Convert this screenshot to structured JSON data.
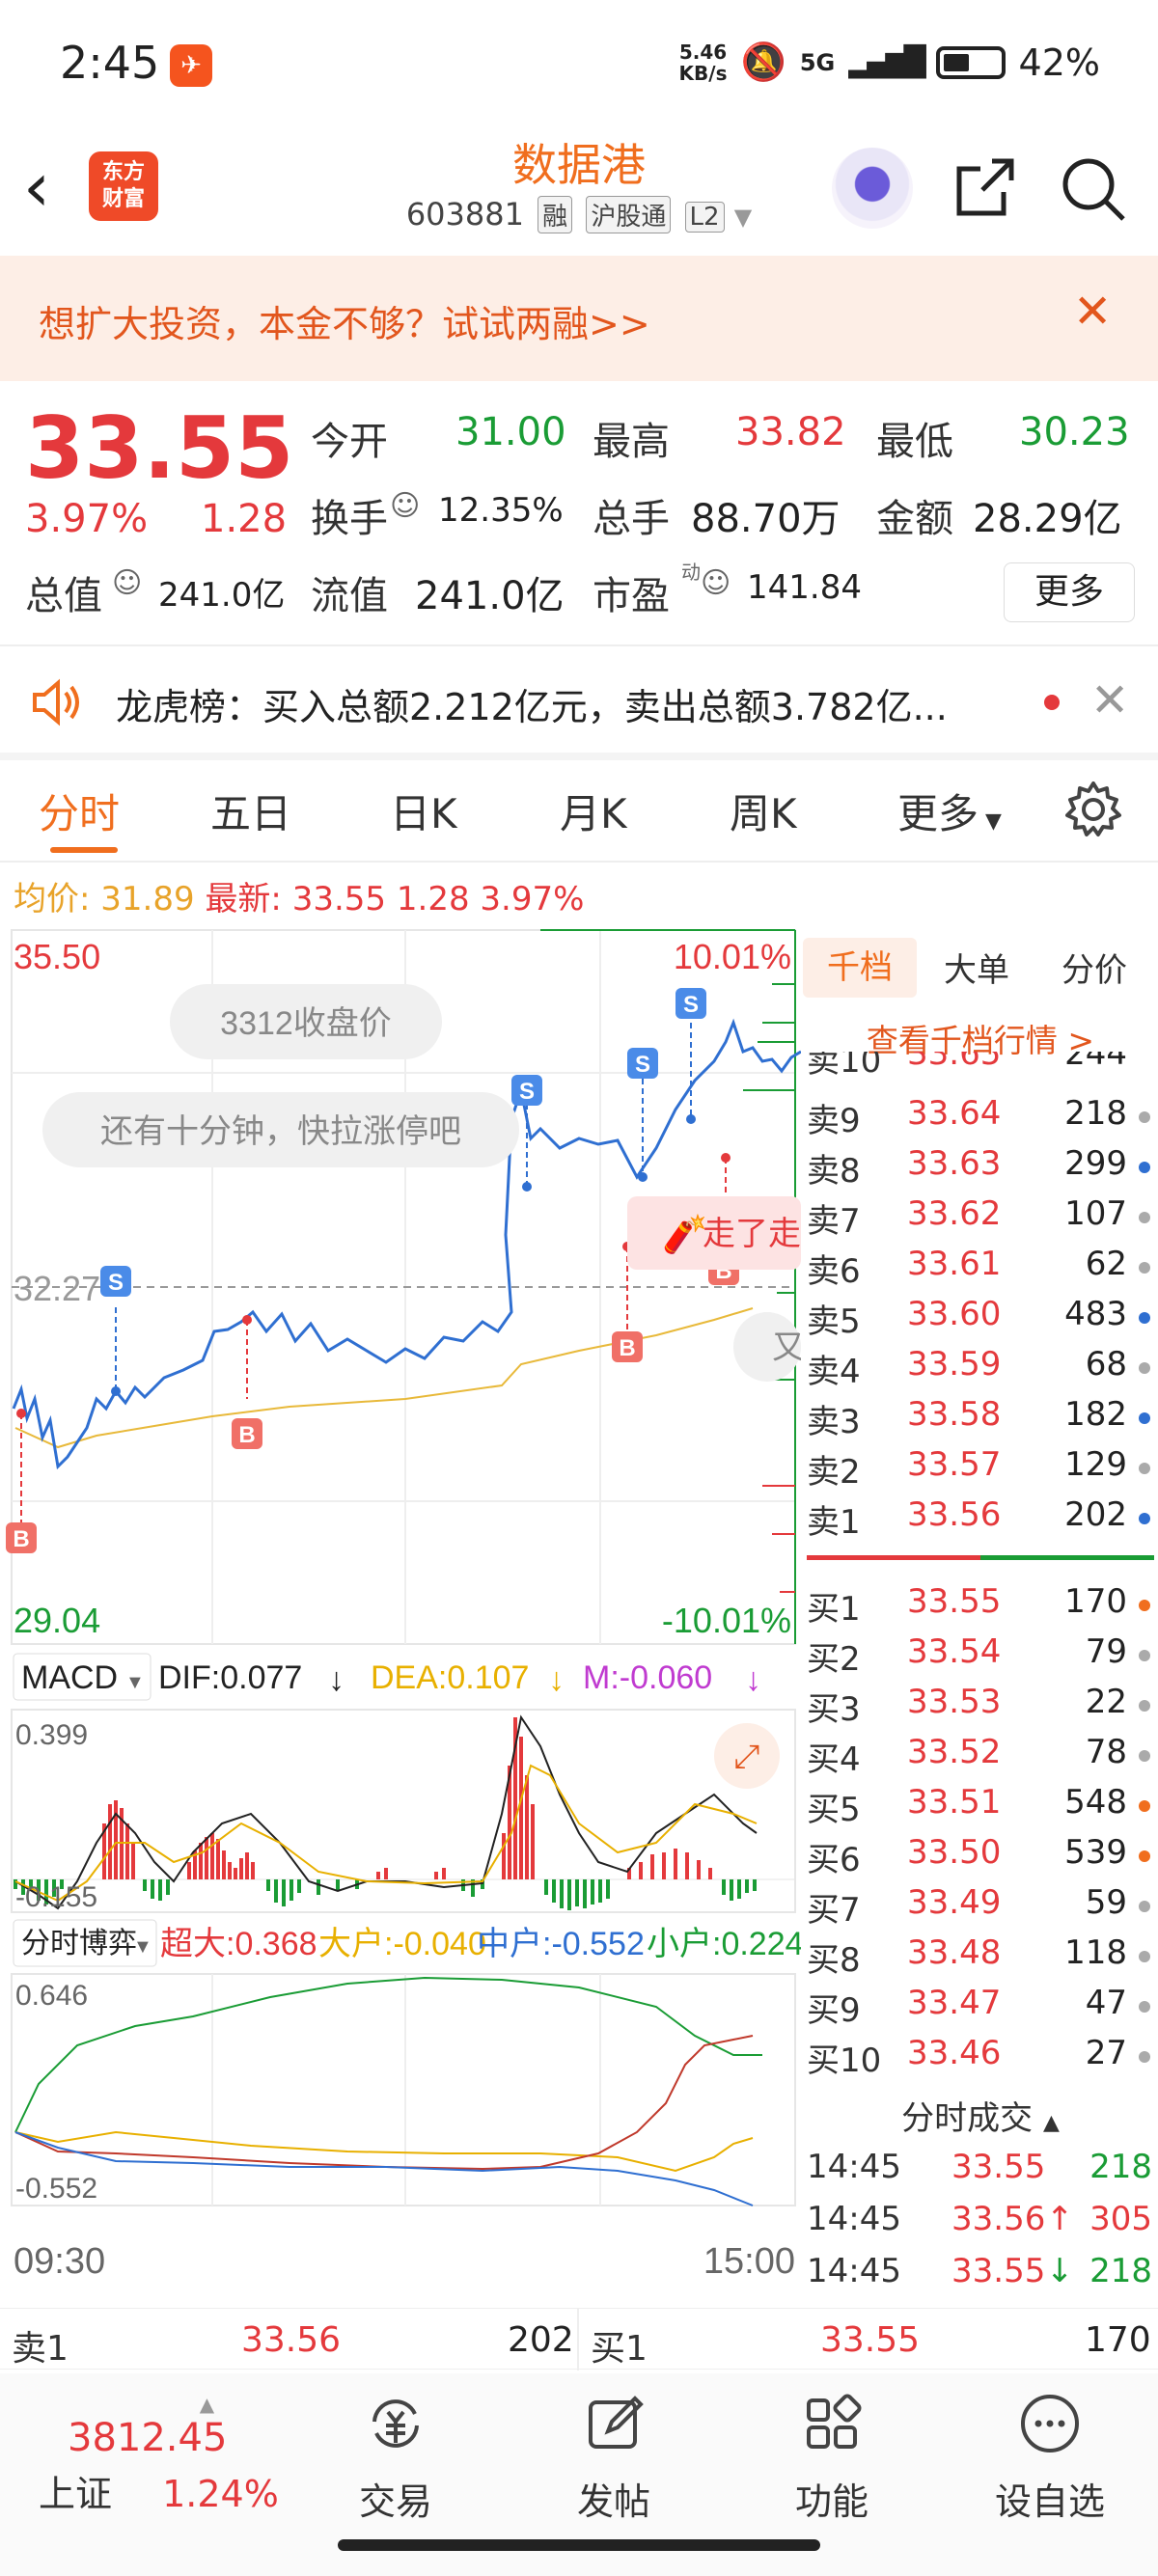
{
  "status": {
    "time": "2:45",
    "speed_value": "5.46",
    "speed_unit": "KB/s",
    "network": "5G",
    "battery": "42%"
  },
  "header": {
    "title": "数据港",
    "code": "603881",
    "tags": [
      "融",
      "沪股通",
      "L2"
    ],
    "logo_line1": "东方",
    "logo_line2": "财富"
  },
  "banner": {
    "text": "想扩大投资，本金不够？试试两融>>"
  },
  "quote": {
    "price": "33.55",
    "change_pct": "3.97%",
    "change": "1.28",
    "open_label": "今开",
    "open": "31.00",
    "high_label": "最高",
    "high": "33.82",
    "low_label": "最低",
    "low": "30.23",
    "turnover_label": "换手",
    "turnover": "12.35%",
    "volume_label": "总手",
    "volume": "88.70万",
    "amount_label": "金额",
    "amount": "28.29亿",
    "mktcap_label": "总值",
    "mktcap": "241.0亿",
    "float_label": "流值",
    "float": "241.0亿",
    "pe_label": "市盈",
    "pe_sup": "动",
    "pe": "141.84",
    "more_label": "更多"
  },
  "news": {
    "text": "龙虎榜：买入总额2.212亿元，卖出总额3.782亿..."
  },
  "tabs": [
    "分时",
    "五日",
    "日K",
    "月K",
    "周K",
    "更多"
  ],
  "infoline": {
    "avg_label": "均价:",
    "avg": "31.89",
    "last_label": "最新:",
    "last": "33.55",
    "chg": "1.28",
    "pct": "3.97%"
  },
  "chart_labels": {
    "top_price": "35.50",
    "top_pct": "10.01%",
    "mid_price": "32.27",
    "bottom_price": "29.04",
    "bottom_pct": "-10.01%",
    "bubble1": "3312收盘价",
    "bubble2": "还有十分钟，快拉涨停吧",
    "tag_walk": "走了走",
    "side_char": "又",
    "macd_name": "MACD",
    "dif": "DIF:0.077",
    "dea": "DEA:0.107",
    "m": "M:-0.060",
    "macd_top": "0.399",
    "macd_bottom": "-0.155",
    "flow_name": "分时博弈",
    "super": "超大:0.368",
    "large": "大户:-0.040",
    "medium": "中户:-0.552",
    "small": "小户:0.224",
    "flow_top": "0.646",
    "flow_bottom": "-0.552",
    "t_start": "09:30",
    "t_end": "15:00",
    "buy_marker": "B",
    "sell_marker": "S"
  },
  "book": {
    "tabs": [
      "千档",
      "大单",
      "分价"
    ],
    "link": "查看千档行情 >",
    "partial_top": {
      "k": "卖10",
      "p": "33.65",
      "v": "244"
    },
    "asks": [
      {
        "k": "卖9",
        "p": "33.64",
        "v": "218",
        "dot": "#aaaaaa"
      },
      {
        "k": "卖8",
        "p": "33.63",
        "v": "299",
        "dot": "#2f6fd1"
      },
      {
        "k": "卖7",
        "p": "33.62",
        "v": "107",
        "dot": "#aaaaaa"
      },
      {
        "k": "卖6",
        "p": "33.61",
        "v": "62",
        "dot": "#aaaaaa"
      },
      {
        "k": "卖5",
        "p": "33.60",
        "v": "483",
        "dot": "#2f6fd1"
      },
      {
        "k": "卖4",
        "p": "33.59",
        "v": "68",
        "dot": "#aaaaaa"
      },
      {
        "k": "卖3",
        "p": "33.58",
        "v": "182",
        "dot": "#2f6fd1"
      },
      {
        "k": "卖2",
        "p": "33.57",
        "v": "129",
        "dot": "#aaaaaa"
      },
      {
        "k": "卖1",
        "p": "33.56",
        "v": "202",
        "dot": "#2f6fd1"
      }
    ],
    "bids": [
      {
        "k": "买1",
        "p": "33.55",
        "v": "170",
        "dot": "#f06e1e"
      },
      {
        "k": "买2",
        "p": "33.54",
        "v": "79",
        "dot": "#aaaaaa"
      },
      {
        "k": "买3",
        "p": "33.53",
        "v": "22",
        "dot": "#aaaaaa"
      },
      {
        "k": "买4",
        "p": "33.52",
        "v": "78",
        "dot": "#aaaaaa"
      },
      {
        "k": "买5",
        "p": "33.51",
        "v": "548",
        "dot": "#f06e1e"
      },
      {
        "k": "买6",
        "p": "33.50",
        "v": "539",
        "dot": "#f06e1e"
      },
      {
        "k": "买7",
        "p": "33.49",
        "v": "59",
        "dot": "#aaaaaa"
      },
      {
        "k": "买8",
        "p": "33.48",
        "v": "118",
        "dot": "#aaaaaa"
      },
      {
        "k": "买9",
        "p": "33.47",
        "v": "47",
        "dot": "#aaaaaa"
      },
      {
        "k": "买10",
        "p": "33.46",
        "v": "27",
        "dot": "#aaaaaa"
      }
    ],
    "trades_title": "分时成交",
    "trades": [
      {
        "t": "14:45",
        "p": "33.55",
        "arrow": "",
        "v": "218",
        "vcolor": "#1a9c35"
      },
      {
        "t": "14:45",
        "p": "33.56",
        "arrow": "↑",
        "v": "305",
        "vcolor": "#e4393c"
      },
      {
        "t": "14:45",
        "p": "33.55",
        "arrow": "↓",
        "v": "218",
        "vcolor": "#1a9c35"
      }
    ]
  },
  "strip": {
    "sell_label": "卖1",
    "sell_price": "33.56",
    "sell_vol": "202",
    "buy_label": "买1",
    "buy_price": "33.55",
    "buy_vol": "170"
  },
  "nav": {
    "index_value": "3812.45",
    "index_name": "上证",
    "index_pct": "1.24%",
    "items": [
      "交易",
      "发帖",
      "功能",
      "设自选"
    ]
  }
}
